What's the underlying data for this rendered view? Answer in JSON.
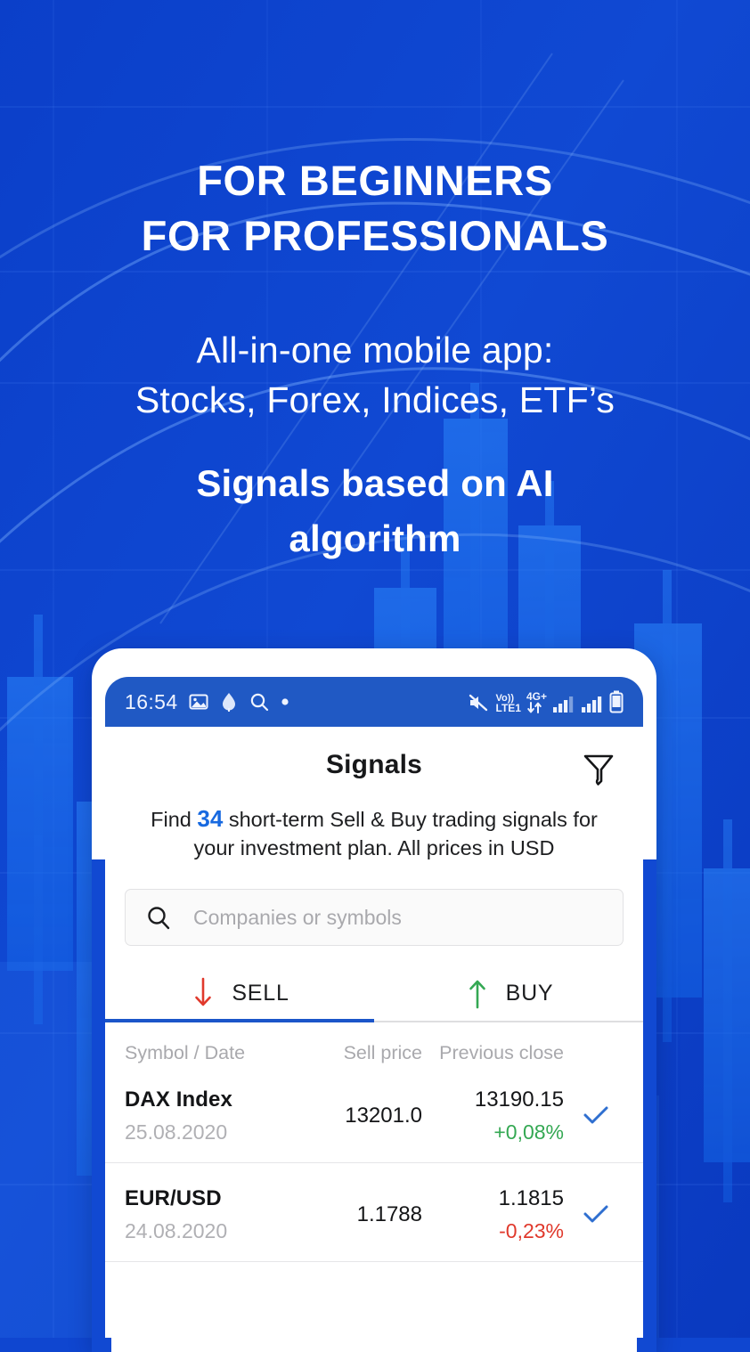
{
  "promo": {
    "headline_line1": "FOR BEGINNERS",
    "headline_line2": "FOR PROFESSIONALS",
    "subhead_line1": "All-in-one mobile app:",
    "subhead_line2": "Stocks, Forex, Indices, ETF’s",
    "tagline_line1": "Signals based on AI",
    "tagline_line2": "algorithm"
  },
  "status_bar": {
    "time": "16:54",
    "left_icons": [
      "image-icon",
      "dropper-icon",
      "search-icon",
      "dot-icon"
    ],
    "network_label_top": "Vo))",
    "network_label_bottom": "LTE1",
    "data_label": "4G+",
    "right_icons": [
      "mute-icon",
      "volte-icon",
      "4g-plus-icon",
      "data-arrows-icon",
      "signal-bars-1-icon",
      "signal-bars-2-icon",
      "battery-icon"
    ]
  },
  "app": {
    "title": "Signals",
    "filter_icon": "funnel-icon",
    "intro": {
      "before": "Find ",
      "count": "34",
      "after": " short-term Sell & Buy trading signals for your investment plan. All prices in USD"
    },
    "search": {
      "placeholder": "Companies or symbols",
      "icon": "search-icon",
      "value": ""
    },
    "tabs": [
      {
        "label": "SELL",
        "icon": "arrow-down-icon",
        "icon_color": "#e0392c",
        "active": true
      },
      {
        "label": "BUY",
        "icon": "arrow-up-icon",
        "icon_color": "#34a853",
        "active": false
      }
    ],
    "table": {
      "headers": {
        "symbol": "Symbol / Date",
        "sell_price": "Sell price",
        "previous_close": "Previous close"
      },
      "rows": [
        {
          "symbol": "DAX Index",
          "date": "25.08.2020",
          "sell_price": "13201.0",
          "previous_close": "13190.15",
          "change_pct": "+0,08%",
          "direction": "up",
          "checked": true
        },
        {
          "symbol": "EUR/USD",
          "date": "24.08.2020",
          "sell_price": "1.1788",
          "previous_close": "1.1815",
          "change_pct": "-0,23%",
          "direction": "down",
          "checked": true
        }
      ]
    }
  },
  "colors": {
    "background_blue": "#0f46d0",
    "candle_blue": "#1a72f0",
    "status_bar_blue": "#2059c4",
    "accent_blue": "#1769e0",
    "tab_underline": "#1b55c9",
    "up_green": "#34a853",
    "down_red": "#e0392c",
    "check_blue": "#2f6fd0"
  }
}
